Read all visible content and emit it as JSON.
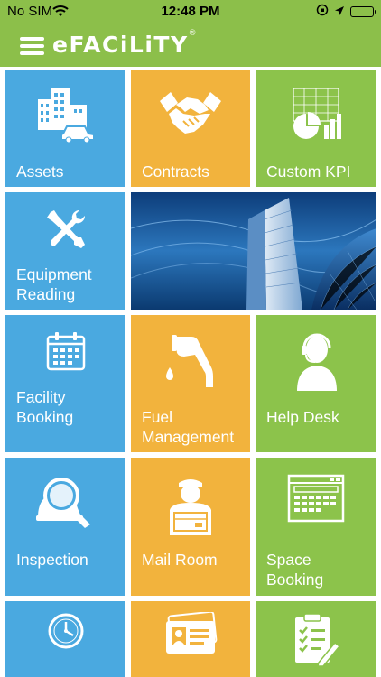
{
  "status_bar": {
    "carrier": "No SIM",
    "time": "12:48 PM"
  },
  "header": {
    "app_name": "eFACiLiTY",
    "registered_mark": "®"
  },
  "tiles": [
    {
      "label": "Assets",
      "icon": "buildings-car-icon",
      "color": "#4aa9e0"
    },
    {
      "label": "Contracts",
      "icon": "handshake-icon",
      "color": "#f2b33d"
    },
    {
      "label": "Custom KPI",
      "icon": "kpi-chart-icon",
      "color": "#8cc34b"
    },
    {
      "label": "Equipment\nReading",
      "icon": "wrench-screwdriver-icon",
      "color": "#4aa9e0"
    },
    {
      "label": "Facility\nBooking",
      "icon": "calendar-icon",
      "color": "#4aa9e0"
    },
    {
      "label": "Fuel\nManagement",
      "icon": "fuel-nozzle-icon",
      "color": "#f2b33d"
    },
    {
      "label": "Help Desk",
      "icon": "headset-agent-icon",
      "color": "#8cc34b"
    },
    {
      "label": "Inspection",
      "icon": "magnifier-helmet-icon",
      "color": "#4aa9e0"
    },
    {
      "label": "Mail Room",
      "icon": "courier-box-icon",
      "color": "#f2b33d"
    },
    {
      "label": "Space\nBooking",
      "icon": "booking-window-icon",
      "color": "#8cc34b"
    },
    {
      "label": "",
      "icon": "clock-icon",
      "color": "#4aa9e0"
    },
    {
      "label": "",
      "icon": "id-card-icon",
      "color": "#f2b33d"
    },
    {
      "label": "",
      "icon": "checklist-icon",
      "color": "#8cc34b"
    }
  ]
}
